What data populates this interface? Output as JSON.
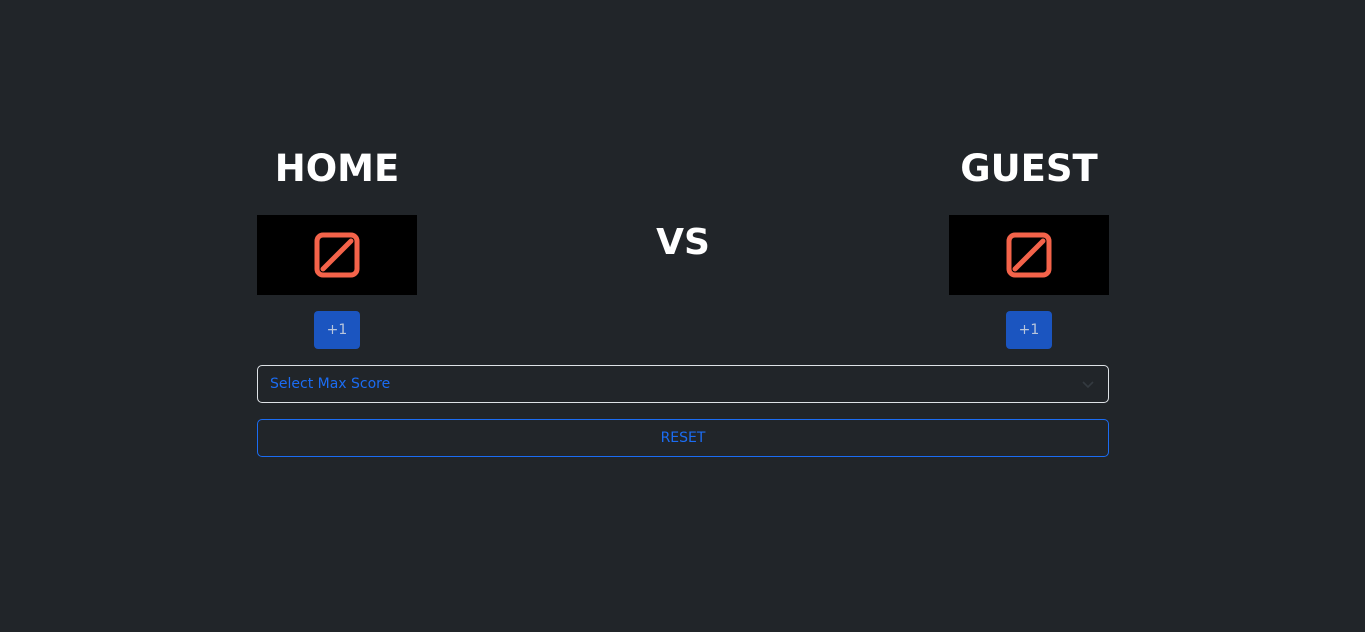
{
  "home": {
    "name": "HOME",
    "score_icon": "slashed-zero-icon",
    "add_label": "+1"
  },
  "guest": {
    "name": "GUEST",
    "score_icon": "slashed-zero-icon",
    "add_label": "+1"
  },
  "vs_label": "VS",
  "max_score_select": {
    "selected": "Select Max Score",
    "icon": "chevron-down-icon"
  },
  "reset_label": "RESET",
  "colors": {
    "background": "#212529",
    "score_icon": "#f4634a",
    "primary": "#1b6cf2",
    "button_fill": "#1b55c0"
  }
}
